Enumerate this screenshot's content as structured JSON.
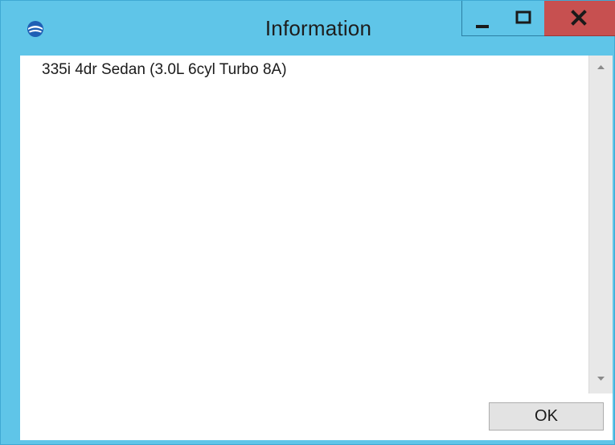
{
  "window": {
    "title": "Information",
    "app_icon": "globe-icon",
    "controls": {
      "minimize": "minimize-icon",
      "maximize": "maximize-icon",
      "close": "close-icon"
    },
    "colors": {
      "titlebar": "#5fc5e8",
      "close_button": "#c75050"
    }
  },
  "content": {
    "text": "335i 4dr Sedan (3.0L 6cyl Turbo 8A)"
  },
  "scrollbar": {
    "up_icon": "scroll-up-arrow-icon",
    "down_icon": "scroll-down-arrow-icon"
  },
  "buttons": {
    "ok_label": "OK"
  }
}
